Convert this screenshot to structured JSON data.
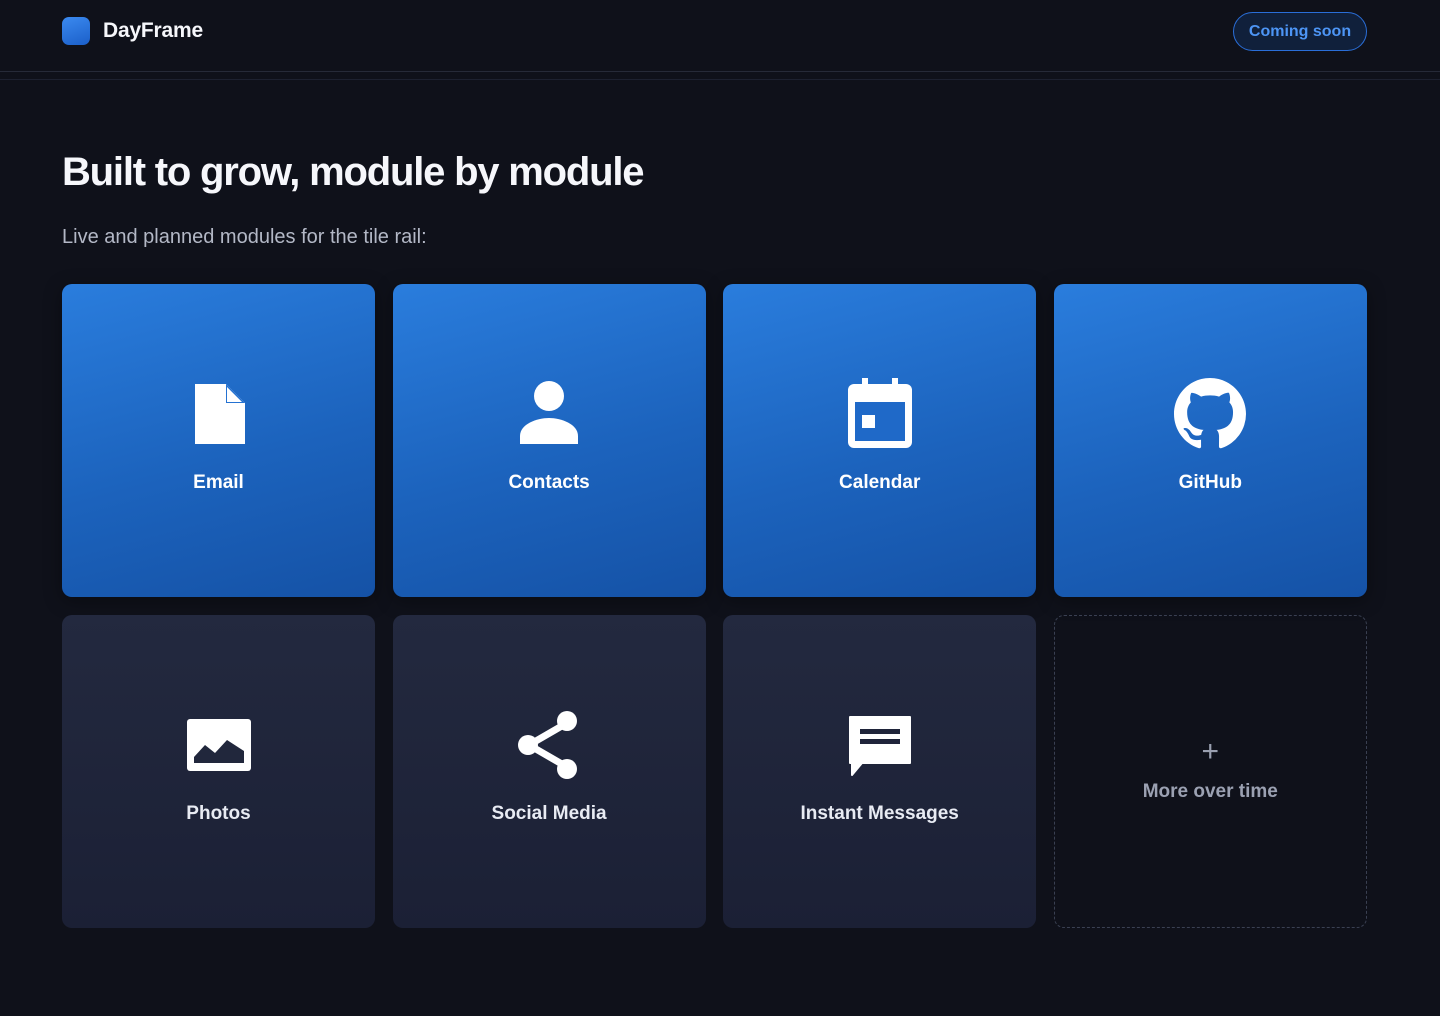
{
  "header": {
    "brand_name": "DayFrame",
    "cta_label": "Coming soon"
  },
  "main": {
    "title": "Built to grow, module by module",
    "subtitle": "Live and planned modules for the tile rail:",
    "modules": [
      {
        "label": "Email",
        "icon": "document-icon",
        "status": "live"
      },
      {
        "label": "Contacts",
        "icon": "person-icon",
        "status": "live"
      },
      {
        "label": "Calendar",
        "icon": "calendar-icon",
        "status": "live"
      },
      {
        "label": "GitHub",
        "icon": "github-icon",
        "status": "live"
      },
      {
        "label": "Photos",
        "icon": "photo-icon",
        "status": "planned"
      },
      {
        "label": "Social Media",
        "icon": "share-icon",
        "status": "planned"
      },
      {
        "label": "Instant Messages",
        "icon": "chat-icon",
        "status": "planned"
      }
    ],
    "more": {
      "symbol": "+",
      "label": "More over time"
    }
  },
  "colors": {
    "background": "#0f111a",
    "accent": "#2a7ddd",
    "planned_tile": "#1f2439"
  }
}
